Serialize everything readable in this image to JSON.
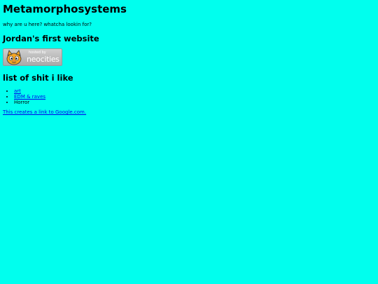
{
  "page": {
    "background": "#00ffee",
    "title": "Metamorphosystems",
    "tagline": "why are u here? whatcha lookin for?",
    "subtitle": "Jordan's first website"
  },
  "badge": {
    "hosted_by": "hosted by",
    "brand": "neocities",
    "icon": "neocities-cat-icon"
  },
  "likes": {
    "heading": "list of shit i like",
    "items": [
      {
        "label": "art",
        "link": true
      },
      {
        "label": "EDM & raves",
        "link": true
      },
      {
        "label": "Horror",
        "link": false
      }
    ]
  },
  "google_link": {
    "label": "This creates a link to Google.com."
  },
  "colors": {
    "link": "#0000ee",
    "text": "#000000"
  }
}
